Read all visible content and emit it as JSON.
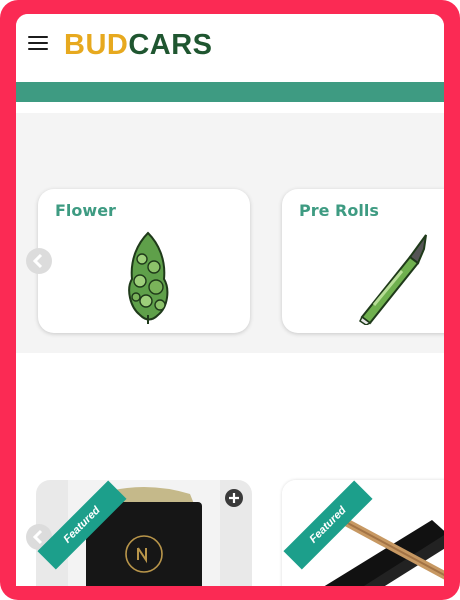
{
  "brand": {
    "part1": "BUD",
    "part2": "CARS"
  },
  "categories": [
    {
      "label": "Flower",
      "icon": "cannabis-bud-icon"
    },
    {
      "label": "Pre Rolls",
      "icon": "pre-roll-joint-icon"
    }
  ],
  "products": [
    {
      "badge": "Featured",
      "image": "sun-flower-pouch-image"
    },
    {
      "badge": "Featured",
      "image": "pre-roll-tubes-image"
    }
  ],
  "colors": {
    "frame": "#fb2a54",
    "accent": "#3e9b82",
    "brand_gold": "#e7a91f",
    "brand_green": "#1f5630",
    "badge": "#1c9f8b"
  }
}
